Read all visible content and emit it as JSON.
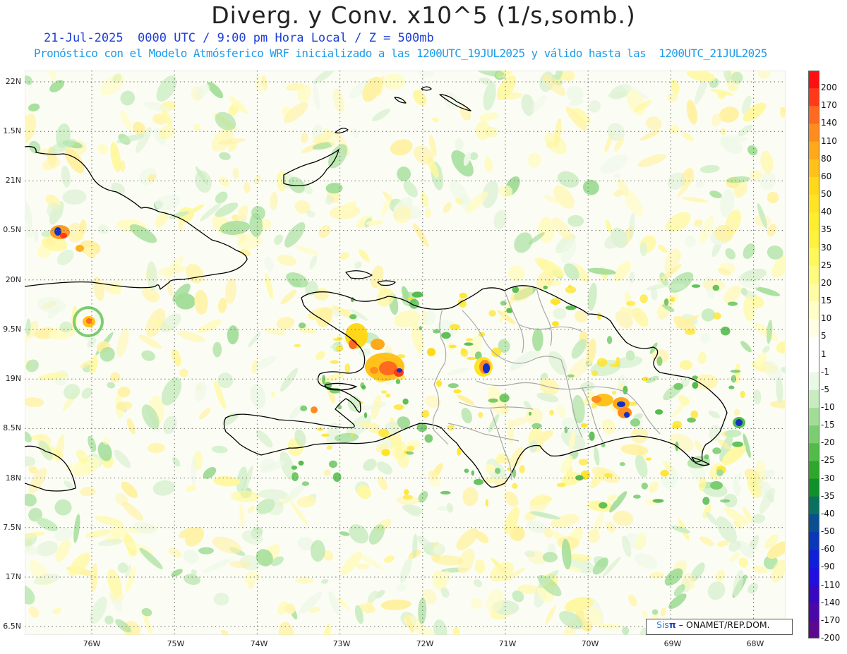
{
  "header": {
    "title": "Diverg. y Conv. x10^5 (1/s,somb.)",
    "subtitle_line1": "21-Jul-2025  0000 UTC / 9:00 pm Hora Local / Z = 500mb",
    "subtitle_line2": "Pronóstico con el Modelo Atmósferico WRF inicializado a las 1200UTC_19JUL2025 y válido hasta las  1200UTC_21JUL2025"
  },
  "axes": {
    "lat_labels": [
      "22N",
      "1.5N",
      "21N",
      "0.5N",
      "20N",
      "9.5N",
      "19N",
      "8.5N",
      "18N",
      "7.5N",
      "17N",
      "6.5N"
    ],
    "lon_labels": [
      "76W",
      "75W",
      "74W",
      "73W",
      "72W",
      "71W",
      "70W",
      "69W",
      "68W"
    ]
  },
  "colorbar": {
    "labels": [
      "200",
      "170",
      "140",
      "110",
      "80",
      "60",
      "50",
      "40",
      "35",
      "30",
      "25",
      "20",
      "15",
      "10",
      "5",
      "1",
      "-1",
      "-5",
      "-10",
      "-15",
      "-20",
      "-25",
      "-30",
      "-35",
      "-40",
      "-50",
      "-60",
      "-90",
      "-110",
      "-140",
      "-170",
      "-200"
    ],
    "colors": [
      "#ff1010",
      "#ff3a1a",
      "#ff6a20",
      "#ff8c1e",
      "#ffa81a",
      "#ffc11a",
      "#ffd81a",
      "#ffe426",
      "#ffee30",
      "#fff23c",
      "#fff85a",
      "#fffa80",
      "#fffca4",
      "#fffdc8",
      "#fffee4",
      "#ffffff",
      "#ffffff",
      "#eaf8e6",
      "#c8ecc0",
      "#a2dd98",
      "#7ccd70",
      "#52bb4a",
      "#2ea82a",
      "#10902a",
      "#0a7060",
      "#0a5090",
      "#0a38b8",
      "#1020d8",
      "#2010e0",
      "#3808c0",
      "#4a08a8",
      "#5c0890"
    ],
    "accent_positive": "#ff0000",
    "accent_negative": "#5c0890"
  },
  "map": {
    "background": "#fbfdf4",
    "coast_color": "#000000",
    "border_color": "#a9a9a9"
  },
  "credit": {
    "brand": "Sis",
    "pi": "π",
    "suffix": "– ONAMET/REP.DOM."
  }
}
